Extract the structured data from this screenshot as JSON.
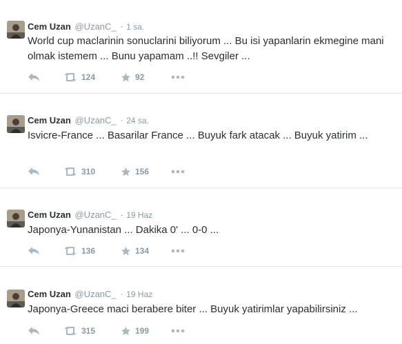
{
  "colors": {
    "text": "#292f33",
    "muted": "#8899a6",
    "icon": "#aab8c2",
    "divider": "#e1e8ed"
  },
  "tweets": [
    {
      "fullname": "Cem Uzan",
      "username": "@UzanC_",
      "time": "1 sa.",
      "text": "World cup maclarinin sonuclarini biliyorum ... Bu isi yapanlarin ekmegine mani olmak istemem ... Bunu yapamam ..!! Sevgiler ...",
      "retweets": "124",
      "favorites": "92",
      "icons": [
        "reply-icon",
        "retweet-icon",
        "favorite-icon",
        "more-icon"
      ]
    },
    {
      "fullname": "Cem Uzan",
      "username": "@UzanC_",
      "time": "24 sa.",
      "text": "Isvicre-France ... Basarilar France ... Buyuk fark atacak ... Buyuk yatirim ...",
      "retweets": "310",
      "favorites": "156",
      "icons": [
        "reply-icon",
        "retweet-icon",
        "favorite-icon",
        "more-icon"
      ]
    },
    {
      "fullname": "Cem Uzan",
      "username": "@UzanC_",
      "time": "19 Haz",
      "text": "Japonya-Yunanistan ... Dakika 0' ... 0-0 ...",
      "retweets": "136",
      "favorites": "134",
      "icons": [
        "reply-icon",
        "retweet-icon",
        "favorite-icon",
        "more-icon"
      ]
    },
    {
      "fullname": "Cem Uzan",
      "username": "@UzanC_",
      "time": "19 Haz",
      "text": "Japonya-Greece maci berabere biter ... Buyuk yatirimlar yapabilirsiniz ...",
      "retweets": "315",
      "favorites": "199",
      "icons": [
        "reply-icon",
        "retweet-icon",
        "favorite-icon",
        "more-icon"
      ]
    }
  ]
}
